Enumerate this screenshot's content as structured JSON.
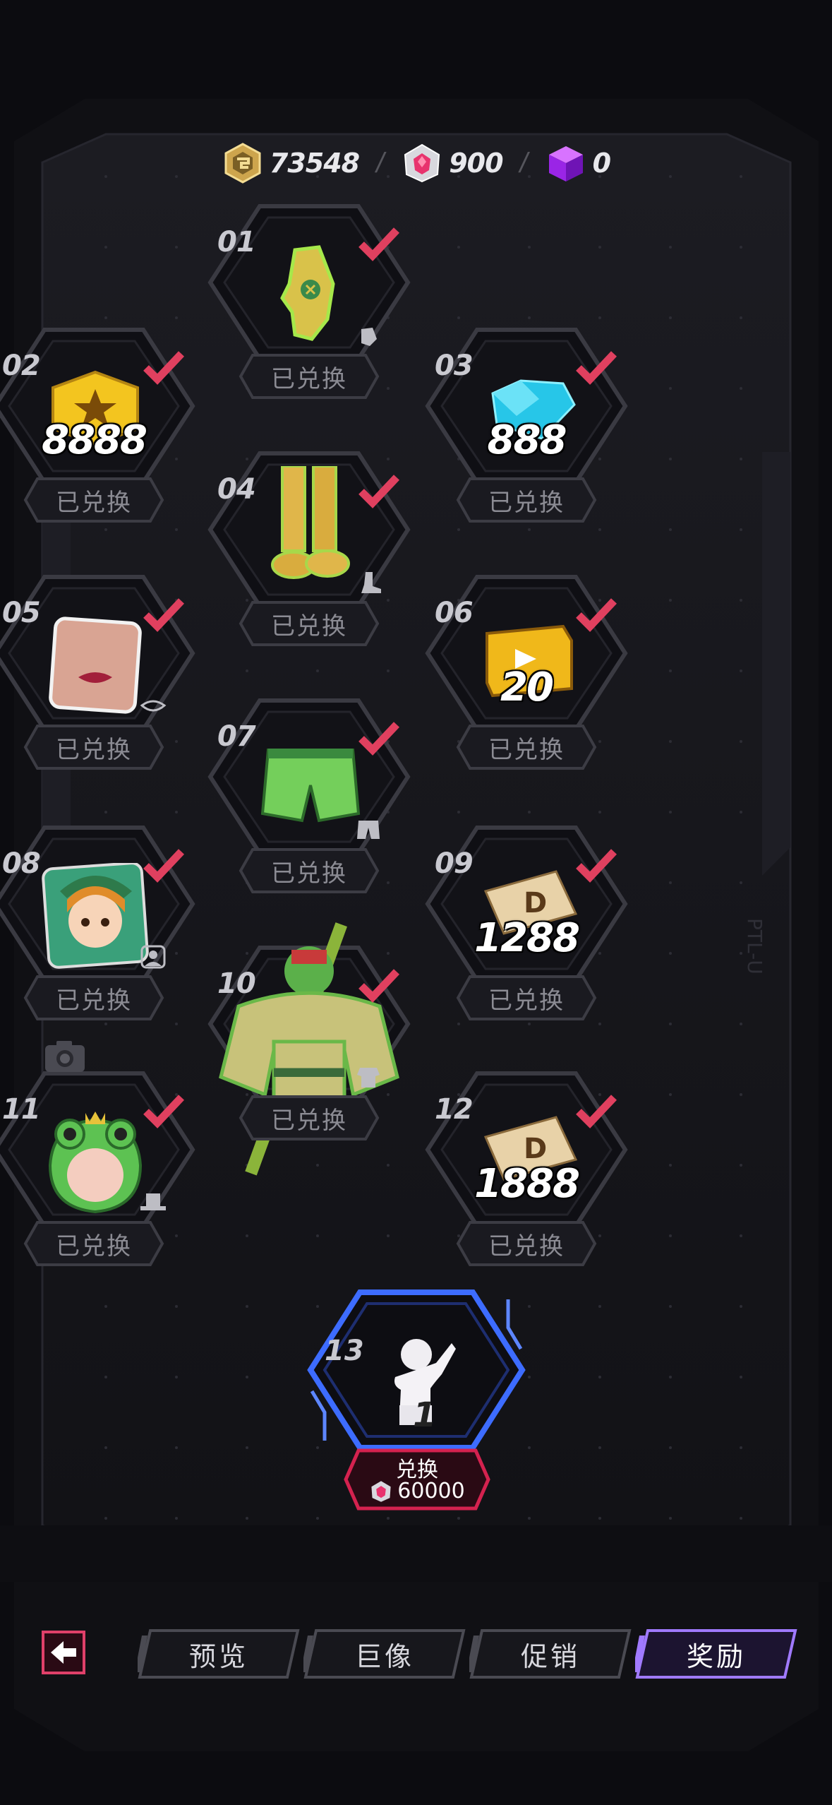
{
  "currencies": [
    {
      "name": "gold-token",
      "value": "73548",
      "color": "#d8b75a"
    },
    {
      "name": "pink-gem",
      "value": "900",
      "color": "#e8336e"
    },
    {
      "name": "purple-cube",
      "value": "0",
      "color": "#b13bff"
    }
  ],
  "rewards": [
    {
      "num": "01",
      "item": "glove-icon",
      "qty": "",
      "type": "glove-type-icon",
      "button": "已兑换",
      "claimed": true
    },
    {
      "num": "02",
      "item": "star-coin-icon",
      "qty": "8888",
      "type": "",
      "button": "已兑换",
      "claimed": true
    },
    {
      "num": "03",
      "item": "diamond-icon",
      "qty": "888",
      "type": "",
      "button": "已兑换",
      "claimed": true
    },
    {
      "num": "04",
      "item": "boots-icon",
      "qty": "",
      "type": "boot-type-icon",
      "button": "已兑换",
      "claimed": true
    },
    {
      "num": "05",
      "item": "lips-face-icon",
      "qty": "",
      "type": "lips-type-icon",
      "button": "已兑换",
      "claimed": true
    },
    {
      "num": "06",
      "item": "gold-ticket-box-icon",
      "qty": "20",
      "type": "",
      "button": "已兑换",
      "claimed": true
    },
    {
      "num": "07",
      "item": "green-shorts-icon",
      "qty": "",
      "type": "pants-type-icon",
      "button": "已兑换",
      "claimed": true
    },
    {
      "num": "08",
      "item": "avatar-portrait-icon",
      "qty": "",
      "type": "avatar-type-icon",
      "button": "已兑换",
      "claimed": true
    },
    {
      "num": "09",
      "item": "parcel-coupon-icon",
      "qty": "1288",
      "type": "",
      "button": "已兑换",
      "claimed": true
    },
    {
      "num": "10",
      "item": "frog-outfit-icon",
      "qty": "",
      "type": "outfit-type-icon",
      "button": "已兑换",
      "claimed": true
    },
    {
      "num": "11",
      "item": "frog-hood-icon",
      "qty": "",
      "type": "hat-type-icon",
      "button": "已兑换",
      "claimed": true
    },
    {
      "num": "12",
      "item": "parcel-coupon-icon",
      "qty": "1888",
      "type": "",
      "button": "已兑换",
      "claimed": true
    }
  ],
  "grand_reward": {
    "num": "13",
    "item": "pose-emote-icon",
    "redeem_label": "兑换",
    "cost": "60000",
    "accent": "#3d6cff",
    "button_color": "#d4224f"
  },
  "tabs": [
    {
      "label": "预览",
      "active": false
    },
    {
      "label": "巨像",
      "active": false
    },
    {
      "label": "促销",
      "active": false
    },
    {
      "label": "奖励",
      "active": true
    }
  ],
  "colors": {
    "check": "#e0405f",
    "active_tab": "#a07aff",
    "back": "#e0406a"
  }
}
